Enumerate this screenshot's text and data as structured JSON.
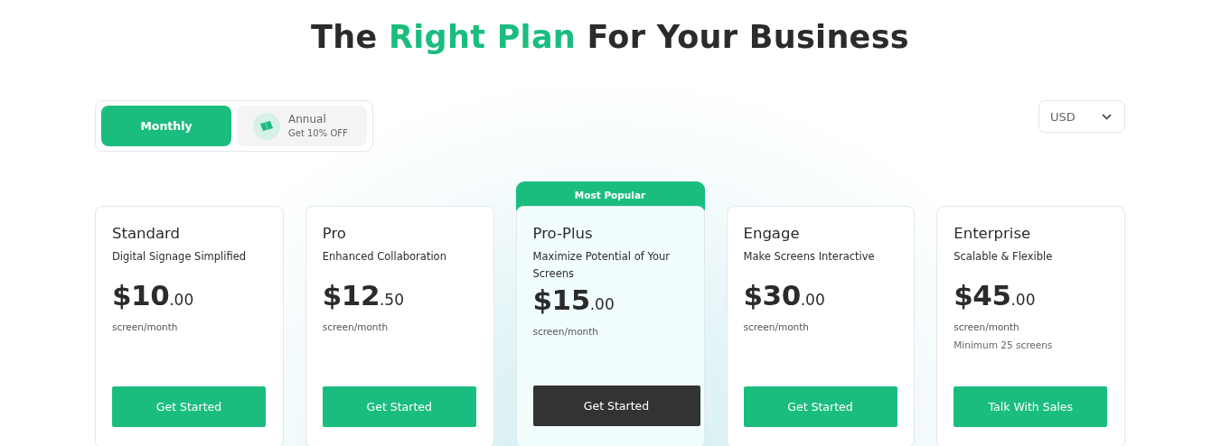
{
  "heading": {
    "before": "The ",
    "highlight": "Right Plan",
    "after": " For Your Business"
  },
  "billing_toggle": [
    {
      "label": "Monthly",
      "selected": true
    },
    {
      "label": "Annual",
      "sublabel": "Get 10% OFF",
      "selected": false
    }
  ],
  "currency": {
    "value": "USD"
  },
  "plans": [
    {
      "name": "Standard",
      "tagline": "Digital Signage Simplified",
      "price": "$10",
      "cents": ".00",
      "unit": "screen/month",
      "button": "Get Started",
      "featured": false
    },
    {
      "name": "Pro",
      "tagline": "Enhanced Collaboration",
      "price": "$12",
      "cents": ".50",
      "unit": "screen/month",
      "button": "Get Started",
      "featured": false
    },
    {
      "name": "Pro-Plus",
      "tagline": "Maximize Potential of Your Screens",
      "price": "$15",
      "cents": ".00",
      "unit": "screen/month",
      "button": "Get Started",
      "featured": true,
      "badge": "Most Popular"
    },
    {
      "name": "Engage",
      "tagline": "Make Screens Interactive",
      "price": "$30",
      "cents": ".00",
      "unit": "screen/month",
      "button": "Get Started",
      "featured": false
    },
    {
      "name": "Enterprise",
      "tagline": "Scalable & Flexible",
      "price": "$45",
      "cents": ".00",
      "unit": "screen/month",
      "note": "Minimum 25 screens",
      "button": "Talk With Sales",
      "featured": false
    }
  ]
}
